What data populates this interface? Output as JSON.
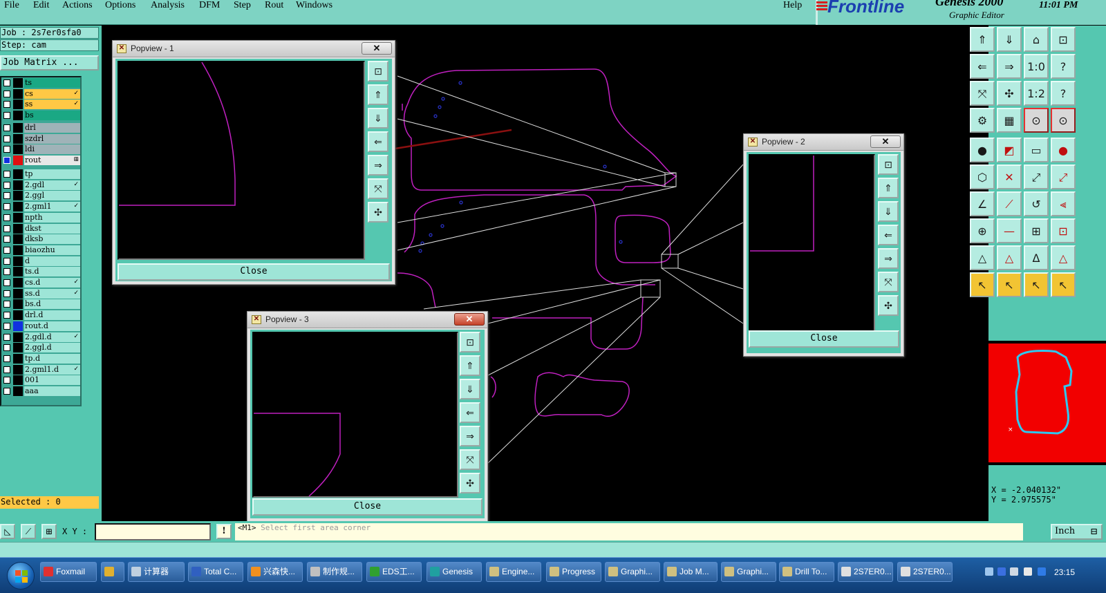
{
  "menubar": {
    "items": [
      "File",
      "Edit",
      "Actions",
      "Options",
      "Analysis",
      "DFM",
      "Step",
      "Rout",
      "Windows"
    ],
    "help": "Help"
  },
  "brand": {
    "logo": "Frontline",
    "product": "Genesis 2000",
    "subtitle": "Graphic Editor",
    "time": "11:01 PM"
  },
  "job": {
    "job_label": "Job : 2s7er0sfa0",
    "step_label": "Step: cam",
    "matrix_button": "Job Matrix ..."
  },
  "layers": [
    {
      "name": "ts",
      "color": "#1aa884",
      "marker": ""
    },
    {
      "name": "cs",
      "color": "#ffc845",
      "marker": "✓"
    },
    {
      "name": "ss",
      "color": "#ffc845",
      "marker": "✓"
    },
    {
      "name": "bs",
      "color": "#1aa884",
      "marker": ""
    },
    {
      "name": "drl",
      "color": "#9fb3b8",
      "marker": ""
    },
    {
      "name": "szdrl",
      "color": "#9fb3b8",
      "marker": ""
    },
    {
      "name": "ldi",
      "color": "#9fb3b8",
      "marker": ""
    },
    {
      "name": "rout",
      "color": "#e8e8e8",
      "marker": "⊞",
      "swatch": "#e01010",
      "checked": true
    },
    {
      "name": "tp",
      "color": "#9ee5d7",
      "marker": ""
    },
    {
      "name": "2.gdl",
      "color": "#9ee5d7",
      "marker": "✓"
    },
    {
      "name": "2.ggl",
      "color": "#9ee5d7",
      "marker": ""
    },
    {
      "name": "2.gml1",
      "color": "#9ee5d7",
      "marker": "✓"
    },
    {
      "name": "npth",
      "color": "#9ee5d7",
      "marker": ""
    },
    {
      "name": "dkst",
      "color": "#9ee5d7",
      "marker": ""
    },
    {
      "name": "dksb",
      "color": "#9ee5d7",
      "marker": ""
    },
    {
      "name": "biaozhu",
      "color": "#9ee5d7",
      "marker": ""
    },
    {
      "name": "d",
      "color": "#9ee5d7",
      "marker": ""
    },
    {
      "name": "ts.d",
      "color": "#9ee5d7",
      "marker": ""
    },
    {
      "name": "cs.d",
      "color": "#9ee5d7",
      "marker": "✓"
    },
    {
      "name": "ss.d",
      "color": "#9ee5d7",
      "marker": "✓"
    },
    {
      "name": "bs.d",
      "color": "#9ee5d7",
      "marker": ""
    },
    {
      "name": "drl.d",
      "color": "#9ee5d7",
      "marker": ""
    },
    {
      "name": "rout.d",
      "color": "#9ee5d7",
      "marker": "",
      "swatch": "#1030e0"
    },
    {
      "name": "2.gdl.d",
      "color": "#9ee5d7",
      "marker": "✓"
    },
    {
      "name": "2.ggl.d",
      "color": "#9ee5d7",
      "marker": ""
    },
    {
      "name": "tp.d",
      "color": "#9ee5d7",
      "marker": ""
    },
    {
      "name": "2.gml1.d",
      "color": "#9ee5d7",
      "marker": "✓"
    },
    {
      "name": "001",
      "color": "#9ee5d7",
      "marker": ""
    },
    {
      "name": "aaa",
      "color": "#9ee5d7",
      "marker": ""
    }
  ],
  "selected": "Selected : 0",
  "command": {
    "xy_label": "X Y :",
    "xy_value": "",
    "bang": "!",
    "message_prefix": "<M1>",
    "message": "Select first area corner",
    "units": "Inch"
  },
  "coordinates": {
    "x": "X = -2.040132\"",
    "y": "Y = 2.975575\""
  },
  "popviews": [
    {
      "title": "Popview - 1",
      "close_label": "Close",
      "title_close": "✕"
    },
    {
      "title": "Popview - 2",
      "close_label": "Close",
      "title_close": "✕"
    },
    {
      "title": "Popview - 3",
      "close_label": "Close",
      "title_close": "✕"
    }
  ],
  "taskbar": {
    "items": [
      "Foxmail",
      "",
      "计算器",
      "Total C...",
      "兴森快...",
      "制作规...",
      "EDS工...",
      "Genesis",
      "Engine...",
      "Progress",
      "Graphi...",
      "Job M...",
      "Graphi...",
      "Drill To...",
      "2S7ER0...",
      "2S7ER0..."
    ],
    "clock": "23:15"
  },
  "colors": {
    "panel": "#55c7b0",
    "profile_line": "#c020c0",
    "zoom_lines": "#e0e0e0",
    "arrow": "#8a1010",
    "minimap_bg": "#f20000",
    "minimap_outline": "#2ec8f0"
  }
}
